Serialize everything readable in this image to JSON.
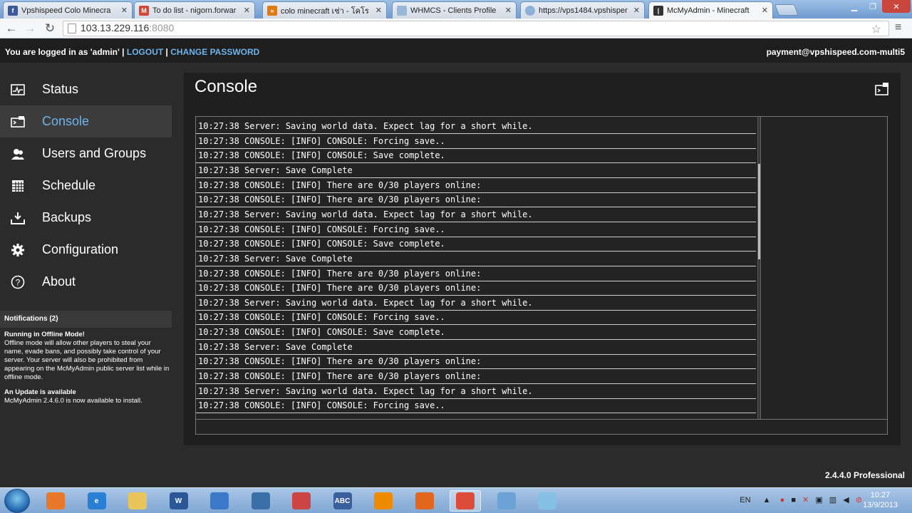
{
  "browser": {
    "tabs": [
      {
        "label": "Vpshispeed Colo Minecra",
        "fav_color": "#3b5998",
        "fav_char": "f"
      },
      {
        "label": "To do list - nigorn.forwar",
        "fav_color": "#d44638",
        "fav_char": "M"
      },
      {
        "label": "colo minecraft เช่า - โคโร",
        "fav_color": "#e07a10",
        "fav_char": "»"
      },
      {
        "label": "WHMCS - Clients Profile",
        "fav_color": "#9bb7d8",
        "fav_char": ""
      },
      {
        "label": "https://vps1484.vpshisper",
        "fav_color": "#8fb0d6",
        "fav_char": ""
      },
      {
        "label": "McMyAdmin - Minecraft",
        "fav_color": "#333333",
        "fav_char": "|"
      }
    ],
    "url_host": "103.13.229.116",
    "url_port": ":8080"
  },
  "header": {
    "logged_in_prefix": "You are logged in as 'admin' | ",
    "logout": "LOGOUT",
    "separator": " | ",
    "change_password": "CHANGE PASSWORD",
    "account": "payment@vpshispeed.com-multi5"
  },
  "sidebar": {
    "items": [
      {
        "label": "Status",
        "icon": "status-icon"
      },
      {
        "label": "Console",
        "icon": "console-icon"
      },
      {
        "label": "Users and Groups",
        "icon": "users-icon"
      },
      {
        "label": "Schedule",
        "icon": "schedule-icon"
      },
      {
        "label": "Backups",
        "icon": "backups-icon"
      },
      {
        "label": "Configuration",
        "icon": "gear-icon"
      },
      {
        "label": "About",
        "icon": "help-icon"
      }
    ],
    "active": "Console",
    "notifications_title": "Notifications (2)",
    "notifications": [
      {
        "title": "Running in Offline Mode!",
        "body": "Offline mode will allow other players to steal your name, evade bans, and possibly take control of your server. Your server will also be prohibited from appearing on the McMyAdmin public server list while in offline mode."
      },
      {
        "title": "An Update is available",
        "body": "McMyAdmin 2.4.6.0 is now available to install."
      }
    ]
  },
  "main": {
    "title": "Console",
    "log": [
      "10:27:38 Server: Saving world data. Expect lag for a short while.",
      "10:27:38 CONSOLE: [INFO] CONSOLE: Forcing save..",
      "10:27:38 CONSOLE: [INFO] CONSOLE: Save complete.",
      "10:27:38 Server: Save Complete",
      "10:27:38 CONSOLE: [INFO] There are 0/30 players online:",
      "10:27:38 CONSOLE: [INFO] There are 0/30 players online:",
      "10:27:38 Server: Saving world data. Expect lag for a short while.",
      "10:27:38 CONSOLE: [INFO] CONSOLE: Forcing save..",
      "10:27:38 CONSOLE: [INFO] CONSOLE: Save complete.",
      "10:27:38 Server: Save Complete",
      "10:27:38 CONSOLE: [INFO] There are 0/30 players online:",
      "10:27:38 CONSOLE: [INFO] There are 0/30 players online:",
      "10:27:38 Server: Saving world data. Expect lag for a short while.",
      "10:27:38 CONSOLE: [INFO] CONSOLE: Forcing save..",
      "10:27:38 CONSOLE: [INFO] CONSOLE: Save complete.",
      "10:27:38 Server: Save Complete",
      "10:27:38 CONSOLE: [INFO] There are 0/30 players online:",
      "10:27:38 CONSOLE: [INFO] There are 0/30 players online:",
      "10:27:38 Server: Saving world data. Expect lag for a short while.",
      "10:27:38 CONSOLE: [INFO] CONSOLE: Forcing save.."
    ]
  },
  "footer": {
    "version": "2.4.4.0 Professional"
  },
  "taskbar": {
    "apps": [
      {
        "name": "media-player-icon",
        "color": "#e8792b",
        "label": ""
      },
      {
        "name": "ie-icon",
        "color": "#2a7fd4",
        "label": "e"
      },
      {
        "name": "explorer-icon",
        "color": "#e8c45a",
        "label": ""
      },
      {
        "name": "word-icon",
        "color": "#2b5797",
        "label": "W"
      },
      {
        "name": "shield-icon",
        "color": "#3c78c8",
        "label": ""
      },
      {
        "name": "python-icon",
        "color": "#3b6fa8",
        "label": ""
      },
      {
        "name": "app-icon",
        "color": "#cc4444",
        "label": ""
      },
      {
        "name": "abc-icon",
        "color": "#3a5f9a",
        "label": "ABC"
      },
      {
        "name": "vlc-icon",
        "color": "#f08a00",
        "label": ""
      },
      {
        "name": "firefox-icon",
        "color": "#e2661e",
        "label": ""
      },
      {
        "name": "chrome-icon",
        "color": "#dd4b39",
        "label": ""
      },
      {
        "name": "network-icon",
        "color": "#6ca3d6",
        "label": ""
      },
      {
        "name": "window-icon",
        "color": "#86c0e4",
        "label": ""
      }
    ],
    "language": "EN",
    "time": "10:27",
    "date": "13/9/2013"
  }
}
